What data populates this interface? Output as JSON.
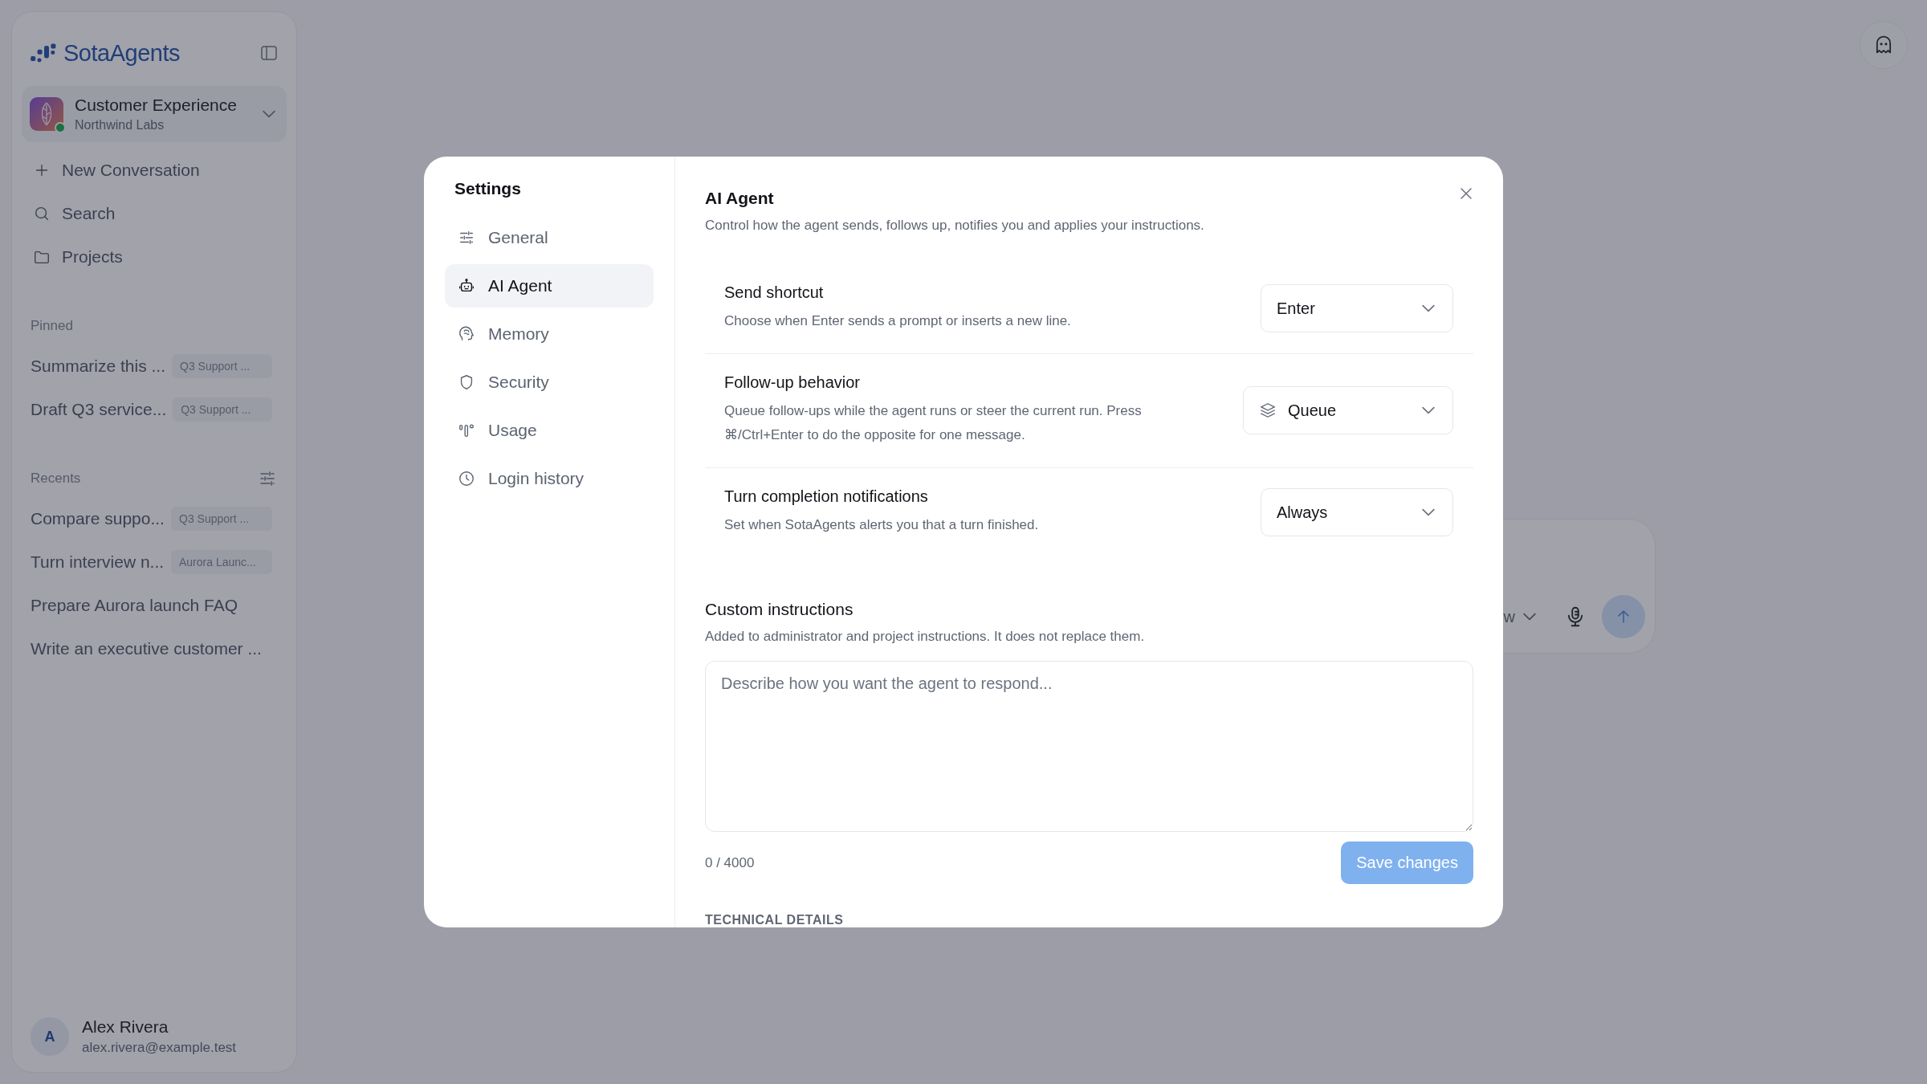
{
  "sidebar": {
    "brand": "SotaAgents",
    "workspace": {
      "name": "Customer Experience",
      "org": "Northwind Labs",
      "online": true
    },
    "actions": [
      {
        "label": "New Conversation",
        "kind": "new"
      },
      {
        "label": "Search",
        "kind": "search"
      },
      {
        "label": "Projects",
        "kind": "projects"
      }
    ],
    "pinned": {
      "heading": "Pinned",
      "items": [
        {
          "title": "Summarize this ...",
          "tag": "Q3 Support ..."
        },
        {
          "title": "Draft Q3 service...",
          "tag": "Q3 Support ..."
        }
      ]
    },
    "recents": {
      "heading": "Recents",
      "items": [
        {
          "title": "Compare suppo...",
          "tag": "Q3 Support ..."
        },
        {
          "title": "Turn interview n...",
          "tag": "Aurora Launc..."
        },
        {
          "title": "Prepare Aurora launch FAQ"
        },
        {
          "title": "Write an executive customer ..."
        }
      ]
    },
    "user": {
      "initial": "A",
      "name": "Alex Rivera",
      "email": "alex.rivera@example.test"
    }
  },
  "composer": {
    "mode_label": "w"
  },
  "settings": {
    "title": "Settings",
    "nav": [
      {
        "label": "General",
        "kind": "sliders",
        "selected": false
      },
      {
        "label": "AI Agent",
        "kind": "robot",
        "selected": true
      },
      {
        "label": "Memory",
        "kind": "brain",
        "selected": false
      },
      {
        "label": "Security",
        "kind": "shield",
        "selected": false
      },
      {
        "label": "Usage",
        "kind": "usage",
        "selected": false
      },
      {
        "label": "Login history",
        "kind": "clock",
        "selected": false
      }
    ],
    "section": {
      "title": "AI Agent",
      "description": "Control how the agent sends, follows up, notifies you and applies your instructions.",
      "rows": [
        {
          "title": "Send shortcut",
          "description": "Choose when Enter sends a prompt or inserts a new line.",
          "value": "Enter",
          "kind": "plain"
        },
        {
          "title": "Follow-up behavior",
          "description": "Queue follow-ups while the agent runs or steer the current run. Press ⌘/Ctrl+Enter to do the opposite for one message.",
          "value": "Queue",
          "kind": "queue"
        },
        {
          "title": "Turn completion notifications",
          "description": "Set when SotaAgents alerts you that a turn finished.",
          "value": "Always",
          "kind": "plain"
        }
      ],
      "custom": {
        "title": "Custom instructions",
        "description": "Added to administrator and project instructions. It does not replace them.",
        "placeholder": "Describe how you want the agent to respond...",
        "counter": "0 / 4000",
        "save_label": "Save changes",
        "save_disabled": true
      },
      "next_heading": "TECHNICAL DETAILS"
    }
  }
}
